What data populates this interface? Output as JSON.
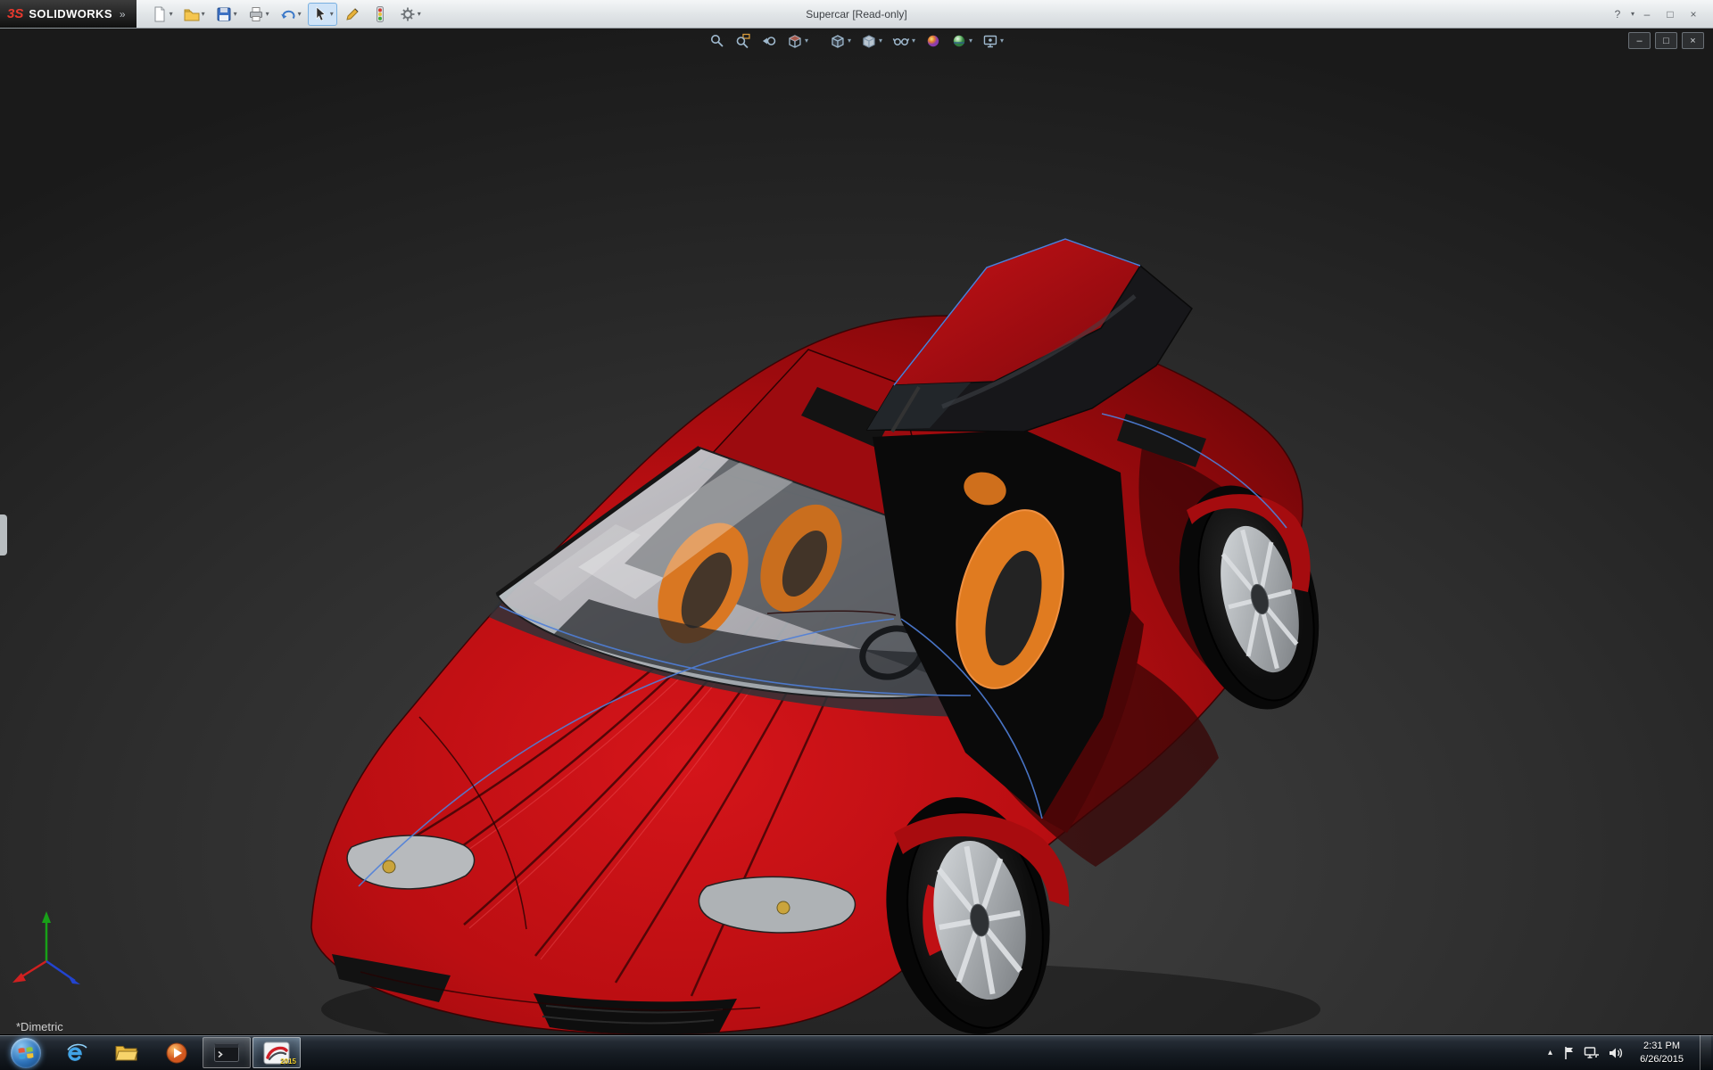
{
  "app": {
    "logo_mark": "3S",
    "brand": "SOLIDWORKS",
    "menu_expand": "»",
    "title": "Supercar [Read-only]"
  },
  "titlebar": {
    "caret": "▾",
    "help": "?",
    "minimize": "–",
    "maximize": "□",
    "close": "×",
    "tools": [
      "new-document",
      "open",
      "save",
      "print",
      "undo",
      "select",
      "sketch",
      "rebuild",
      "options"
    ]
  },
  "hud": {
    "caret": "▾",
    "tools": [
      "zoom-to-fit",
      "zoom-to-area",
      "previous-view",
      "section-view",
      "view-orientation",
      "display-style",
      "hide-show-items",
      "edit-appearance",
      "apply-scene",
      "view-settings"
    ]
  },
  "mdi": {
    "minimize": "–",
    "restore": "□",
    "close": "×"
  },
  "viewport": {
    "view_label": "*Dimetric",
    "triad": [
      "x-axis-red",
      "y-axis-green",
      "z-axis-blue"
    ]
  },
  "model": {
    "name": "Supercar",
    "body_color": "#b90d10",
    "edge_highlight_color": "#4f7fd9",
    "seat_color": "#e0791f",
    "door_state": "open"
  },
  "taskbar": {
    "buttons": [
      "start",
      "internet-explorer",
      "windows-explorer",
      "media-player",
      "command-prompt",
      "solidworks"
    ],
    "solidworks_badge": "2015",
    "tray_expand": "▴",
    "tray_icons": [
      "action-center",
      "network",
      "volume"
    ],
    "clock": {
      "time": "2:31 PM",
      "date": "6/26/2015"
    }
  }
}
